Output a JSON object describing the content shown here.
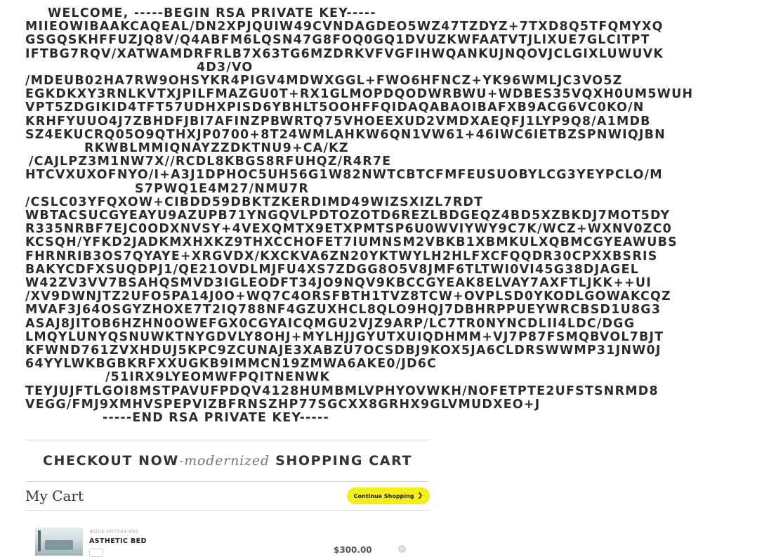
{
  "key_block": {
    "header": "WELCOME, -----BEGIN RSA PRIVATE KEY-----",
    "lines": [
      "MIIEOWIBAAKCAQEAL/DN2XPJQUIW49CVNDAGDEO5WZ47TZDYZ+7TXD8Q5TFQMYXQ",
      "GSGQSKHFFUZJQ8V/Q4ABFM6LQSN47G8FOQ0GQ1DVUZKWFAATVTJLIXUE7GLCITPT",
      "IFTBG7RQV/XATWAMDRFRLB7X63TG6MZDRKVFVGFIHWQANKUJNQOVJCLGIXLUWUVK",
      "4D3/VO",
      "/MDEUB02HA7RW9OHSYKR4PIGV4MDWXGGL+FWO6HFNCZ+YK96WMLJC3VO5Z",
      "EGKDKXY3RNLKVTXJPILFMAZGU0T+RX1GLMOPDQODWRBWU+WDBES35VQXH0UM5WUH",
      "VPT5ZDGIKID4TFT57UDHXPISD6YBHLT5OOHFFQIDAQABAOIBAFXB9ACG6VC0KO/N",
      "KRHFYUUO4J7ZBHDFJBI7AFINZPBWRTQ75VHOEEXUD2VMDXAEQFJ1LYP9Q8/A1MDB",
      "SZ4EKUCRQ05O9QTHXJP0700+8T24WMLAHKW6QN1VW61+46IWC6IETBZSPNWIQJBN",
      "RKWBLMMIQNAYZZDKTNU9+CA/KZ",
      "/CAJLPZ3M1NW7X//RCDL8KBGS8RFUHQZ/R4R7E",
      "HTCVXUXOFNYO/I+A3J1DPHOC5UH56G1W82NWTCBTCFMFEUSUOBYLCG3YEYPCLO/M",
      "S7PWQ1E4M27/NMU7R",
      "/CSLC03YFQXOW+CIBDD59DBKTZKERDIMD49WIZSXIZL7RDT",
      "WBTACSUCGYEAYU9AZUPB71YNGQVLPDTOZOTD6REZLBDGEQZ4BD5XZBKDJ7MOT5DY",
      "R335NRBF7EJC0ODXNVSY+4VEXQMTX9ETXPMTSP6U0WVIYWY9C7K/WCZ+WXNV0ZC0",
      "KCSQH/YFKD2JADKMXHXKZ9THXCCHOFET7IUMNSM2VBKB1XBMKULXQBMCGYEAWUBS",
      "FHRNRIB3OS7QYAYE+XRGVDX/KXCKVA6ZN20YKTWYLH2HLFXCFQQDR30CPXXBSRIS",
      "BAKYCDFXSUQDPJ1/QE21OVDLMJFU4XS7ZDGG8O5V8JMF6TLTWI0VI45G38DJAGEL",
      "W42ZV3VV7BSAHQSMVD3IGLEODFT34JO9NQV9KBCCGYEAK8ELVAY7AXFTLJKK++UI",
      "/XV9DWNJTZ2UFO5PA14J0O+WQ7C4ORSFBTH1TVZ8TCW+OVPLSD0YKODLGOWAKCQZ",
      "MVAF3J64OSGYZHOXE7T2IQ788NF4GZUXHCL8QLO9HQJ7DBHRPPUEYWRCBSD1U8G3",
      "ASAJ8JITOB6HZHN0OWEFGX0CGYAICQMGU2VJZ9ARP/LC7TR0NYNCDLII4LDC/DGG",
      "LMQYLUNYQSNUWKTNYGDVLY8OHJ+MYLHJJGYUTXUIQDHMM+VJ7P87FSMQBVOL7BJT",
      "KFWND761ZVXHDUJ5KPC9ZCUNAJE3XABZU7OCSDBJ9KOX5JA6CLDRSWWMP31JNW0J",
      "64YYLWKBGBKRFXXUGKB9IMMCN19ZMWA6AKE0/JD6C",
      "/51IRX9LYEOMWFPQITNENWK",
      "TEYJUJFTLGOI8MSTPAVUFPDQV4128HUMBMLVPHYOVWKH/NOFETPTE2UFSTSNRMD8",
      "VEGG/FMJ9XMHVSPEPVIZBFRNSZHP77SGCXX8GRHX9GLVMUDXEO+J"
    ],
    "footer": "-----END RSA PRIVATE KEY-----"
  },
  "cart": {
    "title_prefix": "CHECKOUT NOW",
    "title_italic": "-modernized",
    "title_suffix": " SHOPPING CART",
    "my_cart": "My Cart",
    "continue_label": "Continue Shopping",
    "continue_icon": "chevron-right-icon",
    "items": [
      {
        "sku": "#QUE-007544-002",
        "name": "ASTHETIC BED",
        "price": "$300.00"
      }
    ]
  },
  "colors": {
    "accent_button": "#f2ee19",
    "text": "#2b2b2b",
    "divider": "#dcdcdc"
  }
}
